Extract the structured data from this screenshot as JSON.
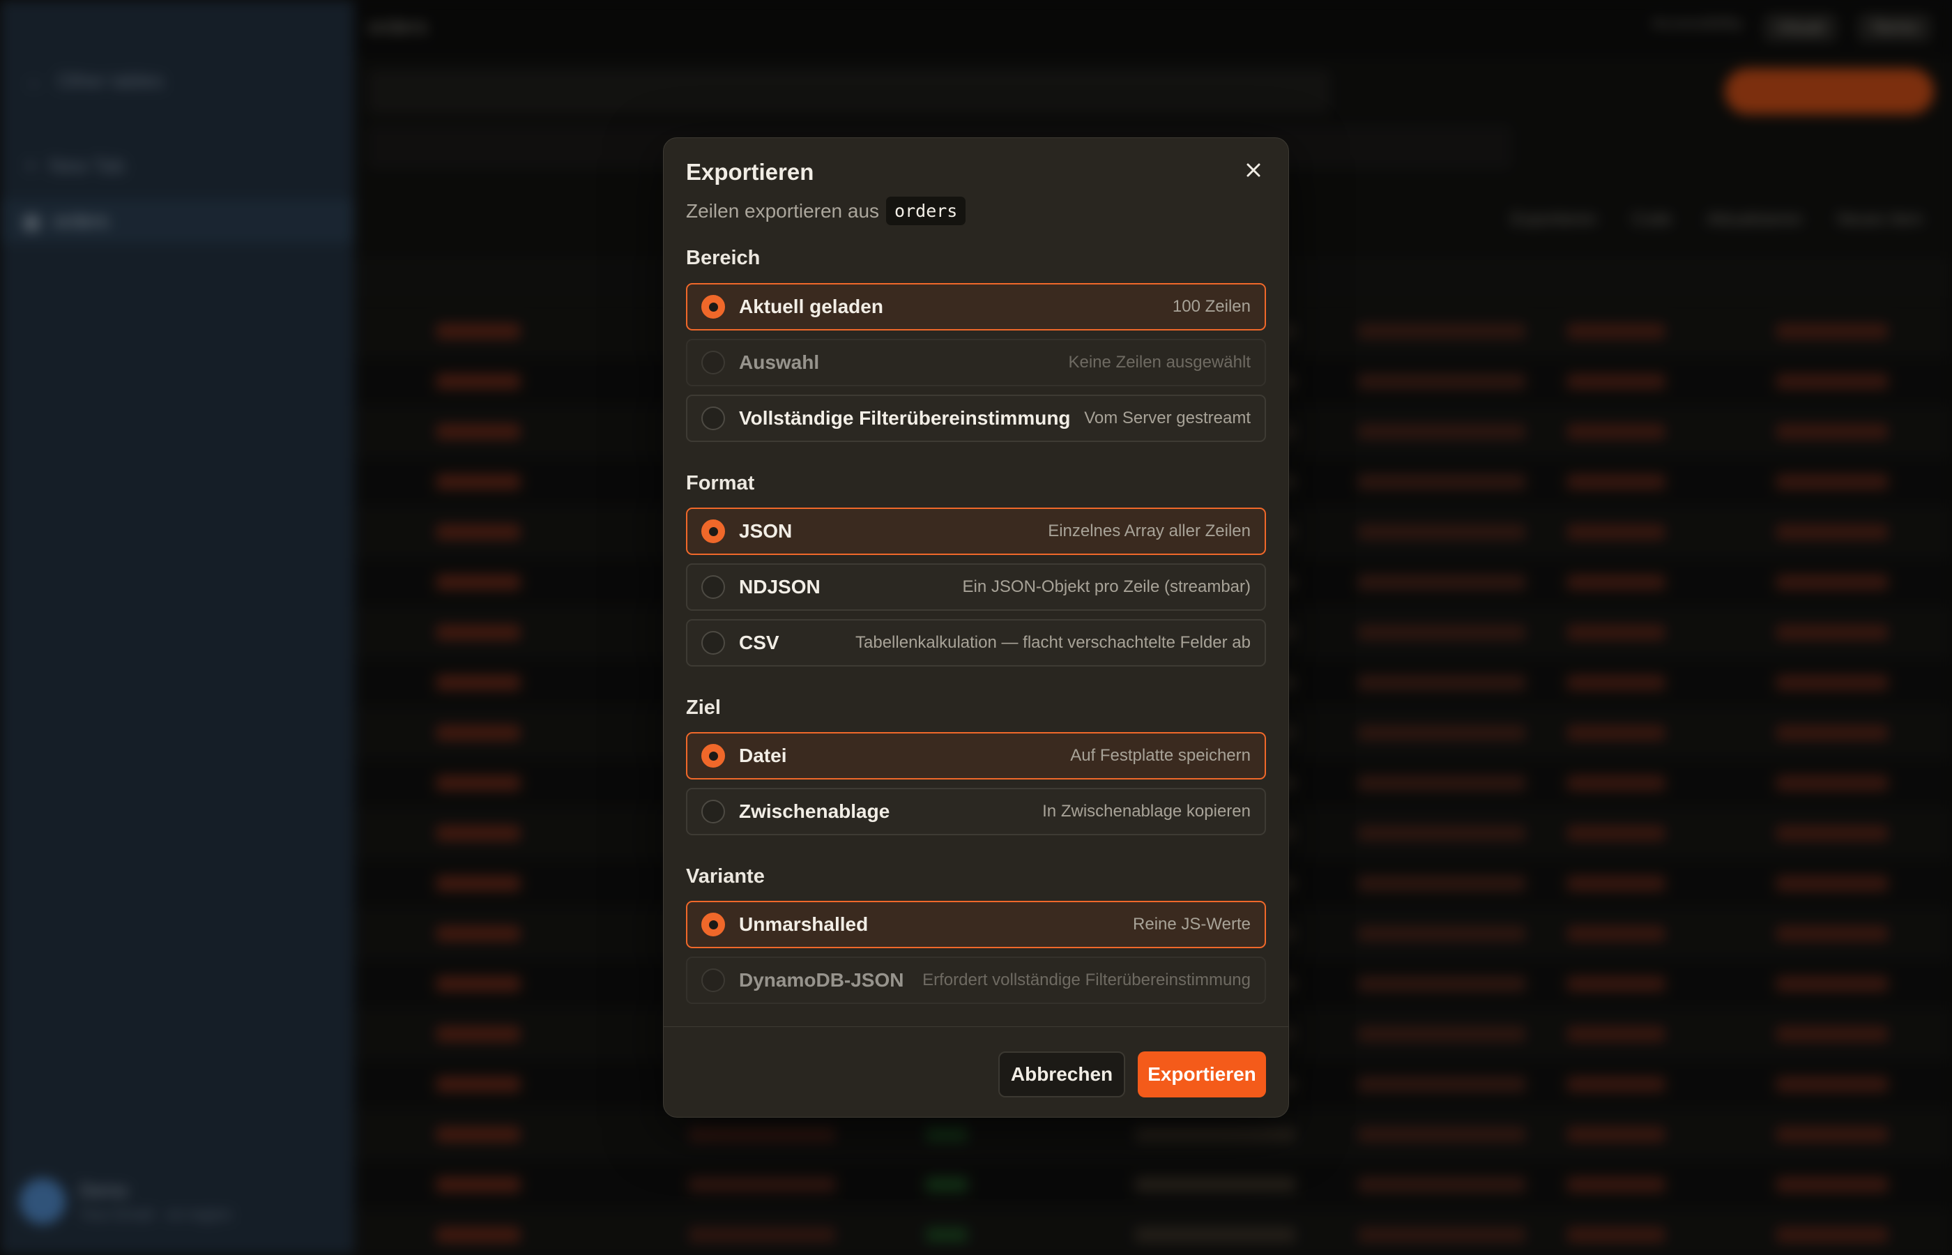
{
  "background": {
    "sidebar": {
      "back_label": "Other tables",
      "new_tab_label": "New Tab",
      "table_label": "orders",
      "user_name": "Demo",
      "user_sub": "Your Email · on-region"
    },
    "topbar": {
      "title": "orders",
      "right_items": [
        "Accessibility",
        "Visual",
        "Terms"
      ]
    },
    "toolbar": {
      "items": [
        "Exportieren",
        "Code",
        "Aktualisieren",
        "Neues Item"
      ]
    }
  },
  "dialog": {
    "title": "Exportieren",
    "subtitle": "Zeilen exportieren aus",
    "table_name": "orders",
    "sections": {
      "range": {
        "label": "Bereich",
        "options": [
          {
            "label": "Aktuell geladen",
            "desc": "100 Zeilen",
            "selected": true,
            "disabled": false
          },
          {
            "label": "Auswahl",
            "desc": "Keine Zeilen ausgewählt",
            "selected": false,
            "disabled": true
          },
          {
            "label": "Vollständige Filterübereinstimmung",
            "desc": "Vom Server gestreamt",
            "selected": false,
            "disabled": false
          }
        ]
      },
      "format": {
        "label": "Format",
        "options": [
          {
            "label": "JSON",
            "desc": "Einzelnes Array aller Zeilen",
            "selected": true,
            "disabled": false
          },
          {
            "label": "NDJSON",
            "desc": "Ein JSON-Objekt pro Zeile (streambar)",
            "selected": false,
            "disabled": false
          },
          {
            "label": "CSV",
            "desc": "Tabellenkalkulation — flacht verschachtelte Felder ab",
            "selected": false,
            "disabled": false
          }
        ]
      },
      "target": {
        "label": "Ziel",
        "options": [
          {
            "label": "Datei",
            "desc": "Auf Festplatte speichern",
            "selected": true,
            "disabled": false
          },
          {
            "label": "Zwischenablage",
            "desc": "In Zwischenablage kopieren",
            "selected": false,
            "disabled": false
          }
        ]
      },
      "variant": {
        "label": "Variante",
        "options": [
          {
            "label": "Unmarshalled",
            "desc": "Reine JS-Werte",
            "selected": true,
            "disabled": false
          },
          {
            "label": "DynamoDB-JSON",
            "desc": "Erfordert vollständige Filterübereinstimmung",
            "selected": false,
            "disabled": true
          }
        ]
      }
    },
    "buttons": {
      "cancel": "Abbrechen",
      "export": "Exportieren"
    }
  },
  "colors": {
    "accent": "#f45b1a",
    "dialog_bg": "#292620",
    "selected_bg": "#3a2a1f"
  }
}
